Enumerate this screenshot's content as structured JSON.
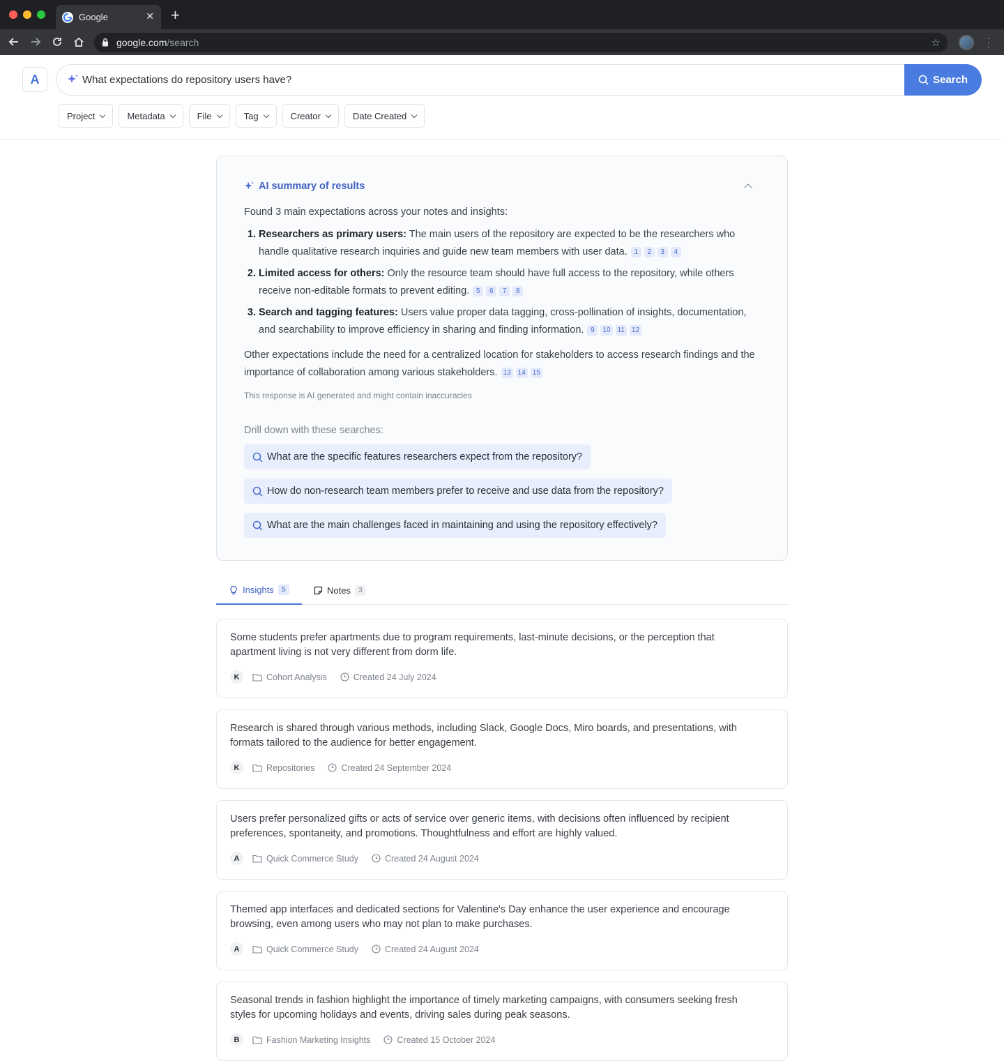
{
  "browser": {
    "tab_title": "Google",
    "url_domain": "google.com",
    "url_path": "/search"
  },
  "app": {
    "logo_letter": "A",
    "search_query": "What expectations do repository users have?",
    "search_button": "Search",
    "filters": [
      "Project",
      "Metadata",
      "File",
      "Tag",
      "Creator",
      "Date Created"
    ]
  },
  "summary": {
    "title": "AI summary of results",
    "intro": "Found 3 main expectations across your notes and insights:",
    "items": [
      {
        "num": "1.",
        "bold": "Researchers as primary users:",
        "text": " The main users of the repository are expected to be the researchers who handle qualitative research inquiries and guide new team members with user data.",
        "cites": [
          "1",
          "2",
          "3",
          "4"
        ]
      },
      {
        "num": "2.",
        "bold": "Limited access for others:",
        "text": " Only the resource team should have full access to the repository, while others receive non-editable formats to prevent editing.",
        "cites": [
          "5",
          "6",
          "7",
          "8"
        ]
      },
      {
        "num": "3.",
        "bold": "Search and tagging features:",
        "text": " Users value proper data tagging, cross-pollination of insights, documentation, and searchability to improve efficiency in sharing and finding information.",
        "cites": [
          "9",
          "10",
          "11",
          "12"
        ]
      }
    ],
    "other": "Other expectations include the need for a centralized location for stakeholders to access research findings and the importance of collaboration among various stakeholders.",
    "other_cites": [
      "13",
      "14",
      "15"
    ],
    "disclaimer": "This response is AI generated and might contain inaccuracies",
    "drill_label": "Drill down with these searches:",
    "drill_searches": [
      "What are the specific features researchers expect from the repository?",
      "How do non-research team members prefer to receive and use data from the repository?",
      "What are the main challenges faced in maintaining and using the repository effectively?"
    ]
  },
  "tabs": {
    "insights_label": "Insights",
    "insights_count": "5",
    "notes_label": "Notes",
    "notes_count": "3"
  },
  "insights": [
    {
      "text": "Some students prefer apartments due to program requirements, last-minute decisions, or the perception that apartment living is not very different from dorm life.",
      "author": "K",
      "project": "Cohort Analysis",
      "created": "Created 24 July 2024"
    },
    {
      "text": "Research is shared through various methods, including Slack, Google Docs, Miro boards, and presentations, with formats tailored to the audience for better engagement.",
      "author": "K",
      "project": "Repositories",
      "created": "Created 24 September 2024"
    },
    {
      "text": "Users prefer personalized gifts or acts of service over generic items, with decisions often influenced by recipient preferences, spontaneity, and promotions. Thoughtfulness and effort are highly valued.",
      "author": "A",
      "project": "Quick Commerce Study",
      "created": "Created 24 August 2024"
    },
    {
      "text": "Themed app interfaces and dedicated sections for Valentine's Day enhance the user experience and encourage browsing, even among users who may not plan to make purchases.",
      "author": "A",
      "project": "Quick Commerce Study",
      "created": "Created 24 August 2024"
    },
    {
      "text": "Seasonal trends in fashion highlight the importance of timely marketing campaigns, with consumers seeking fresh styles for upcoming holidays and events, driving sales during peak seasons.",
      "author": "B",
      "project": "Fashion Marketing Insights",
      "created": "Created 15 October 2024"
    }
  ]
}
